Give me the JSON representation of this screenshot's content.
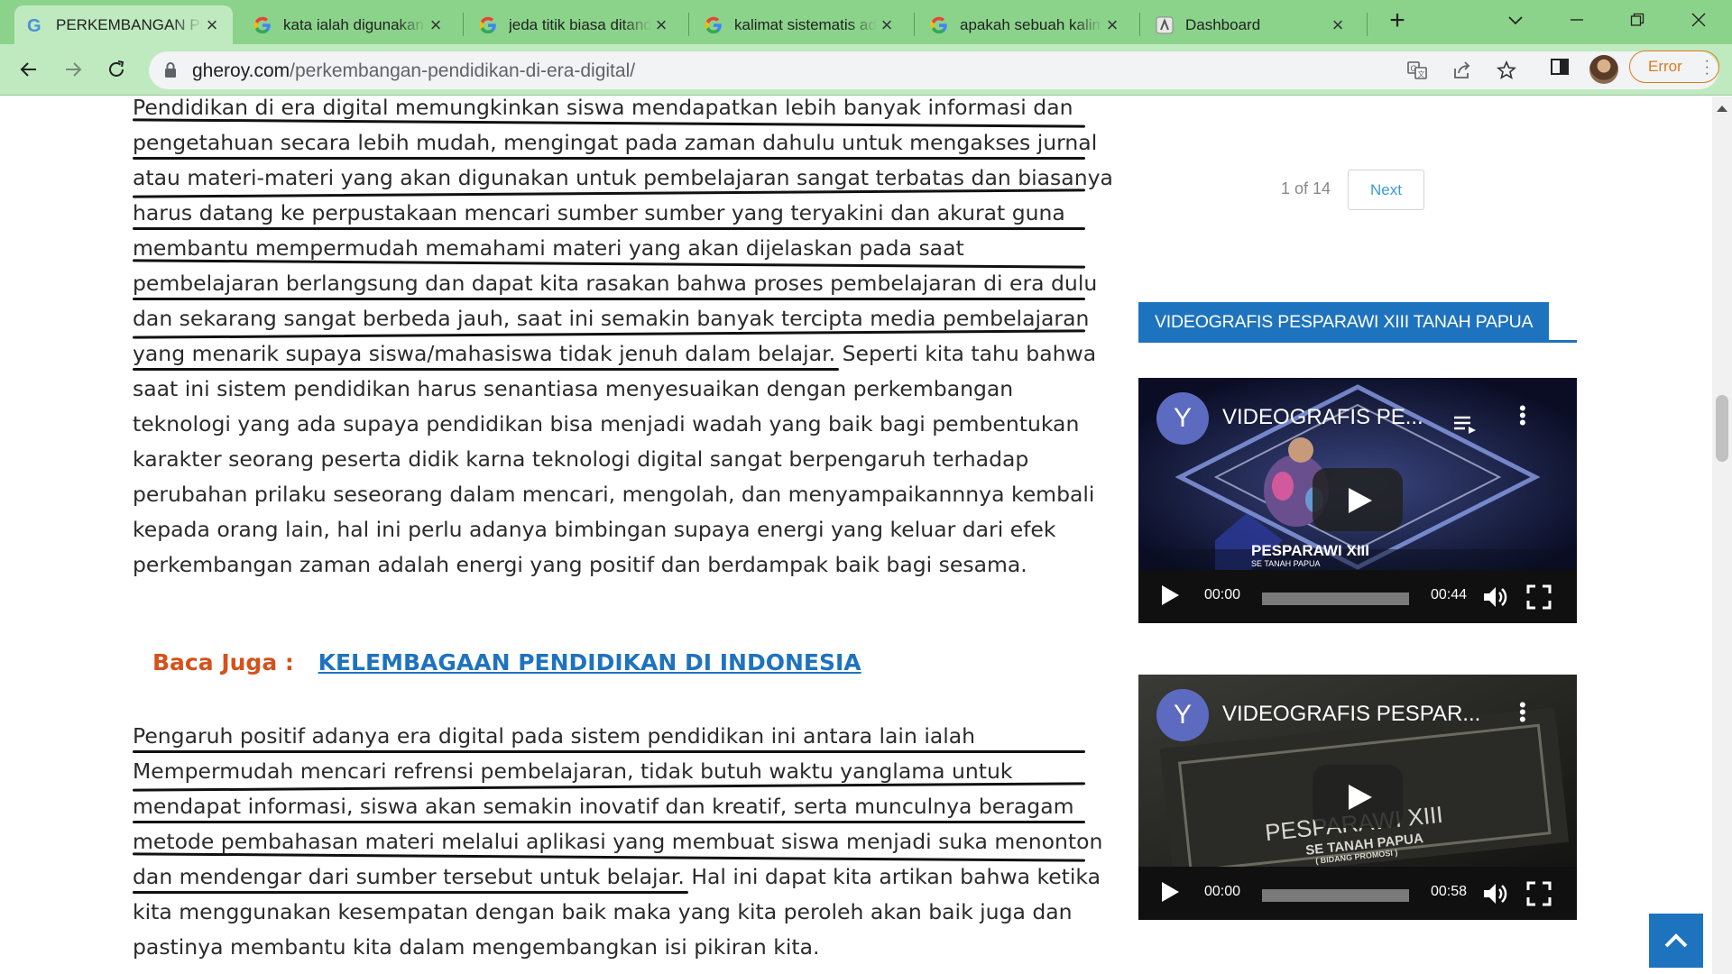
{
  "browser": {
    "tabs": [
      {
        "title": "PERKEMBANGAN PENDIDIKAN DI ERA DIGITAL",
        "icon": "gheroy-g-icon",
        "active": true
      },
      {
        "title": "kata ialah digunakan",
        "icon": "google-icon",
        "active": false
      },
      {
        "title": "jeda titik biasa ditandai",
        "icon": "google-icon",
        "active": false
      },
      {
        "title": "kalimat sistematis adalah",
        "icon": "google-icon",
        "active": false
      },
      {
        "title": "apakah sebuah kalimat",
        "icon": "google-icon",
        "active": false
      },
      {
        "title": "Dashboard",
        "icon": "dashboard-icon",
        "active": false
      }
    ],
    "url_host": "gheroy.com",
    "url_path": "/perkembangan-pendidikan-di-era-digital/",
    "error_label": "Error",
    "colors": {
      "tabstrip": "#8bd38b",
      "toolbar": "#bfeabf",
      "accent": "#1e73be",
      "error": "#e07a1f"
    }
  },
  "article": {
    "paragraph1": [
      "Pendidikan di era digital memungkinkan siswa mendapatkan lebih banyak informasi dan",
      "pengetahuan secara lebih mudah, mengingat pada zaman dahulu untuk mengakses jurnal",
      "atau materi-materi yang akan digunakan untuk pembelajaran sangat terbatas dan biasanya",
      "harus datang ke perpustakaan mencari sumber sumber yang teryakini dan akurat guna",
      "membantu mempermudah memahami materi yang akan dijelaskan pada saat",
      "pembelajaran berlangsung dan dapat kita rasakan bahwa proses pembelajaran di era dulu",
      "dan sekarang sangat berbeda jauh, saat ini semakin banyak tercipta media  pembelajaran",
      "yang menarik supaya siswa/mahasiswa tidak jenuh dalam belajar.",
      " Seperti kita tahu bahwa",
      "saat ini sistem pendidikan harus senantiasa menyesuaikan dengan perkembangan",
      "teknologi yang ada supaya pendidikan bisa menjadi wadah yang baik bagi pembentukan",
      "karakter seorang peserta didik karna teknologi digital sangat berpengaruh terhadap",
      "perubahan prilaku seseorang dalam mencari, mengolah, dan menyampaikannnya kembali",
      "kepada orang lain, hal ini perlu adanya bimbingan supaya energi yang keluar dari efek",
      "perkembangan zaman adalah energi yang positif dan berdampak baik bagi sesama."
    ],
    "baca_juga_label": "Baca Juga :",
    "baca_juga_link": "KELEMBAGAAN PENDIDIKAN DI INDONESIA",
    "paragraph2": [
      "Pengaruh positif adanya era digital pada sistem pendidikan ini antara lain ialah",
      "Mempermudah mencari refrensi pembelajaran, tidak butuh waktu yanglama untuk",
      "mendapat informasi, siswa akan semakin inovatif dan kreatif, serta munculnya beragam",
      "metode pembahasan materi melalui aplikasi yang membuat siswa menjadi suka menonton",
      "dan mendengar dari sumber tersebut untuk belajar.",
      " Hal ini dapat kita artikan bahwa ketika",
      "kita menggunakan kesempatan dengan baik maka yang kita peroleh akan baik juga dan",
      "pastinya membantu kita dalam mengembangkan isi pikiran kita."
    ]
  },
  "sidebar": {
    "pager_count": "1 of 14",
    "pager_next": "Next",
    "widget_title": "VIDEOGRAFIS PESPARAWI XIII TANAH PAPUA",
    "videos": [
      {
        "channel_initial": "Y",
        "title": "VIDEOGRAFIS PE...",
        "overlay_title": "PESPARAWI XIII",
        "overlay_subtitle": "SE TANAH PAPUA",
        "current_time": "00:00",
        "duration": "00:44"
      },
      {
        "channel_initial": "Y",
        "title": "VIDEOGRAFIS PESPAR...",
        "overlay_title": "PESPARAWI XIII",
        "overlay_subtitle": "SE TANAH PAPUA",
        "overlay_note": "( BIDANG PROMOSI )",
        "current_time": "00:00",
        "duration": "00:58"
      }
    ]
  }
}
